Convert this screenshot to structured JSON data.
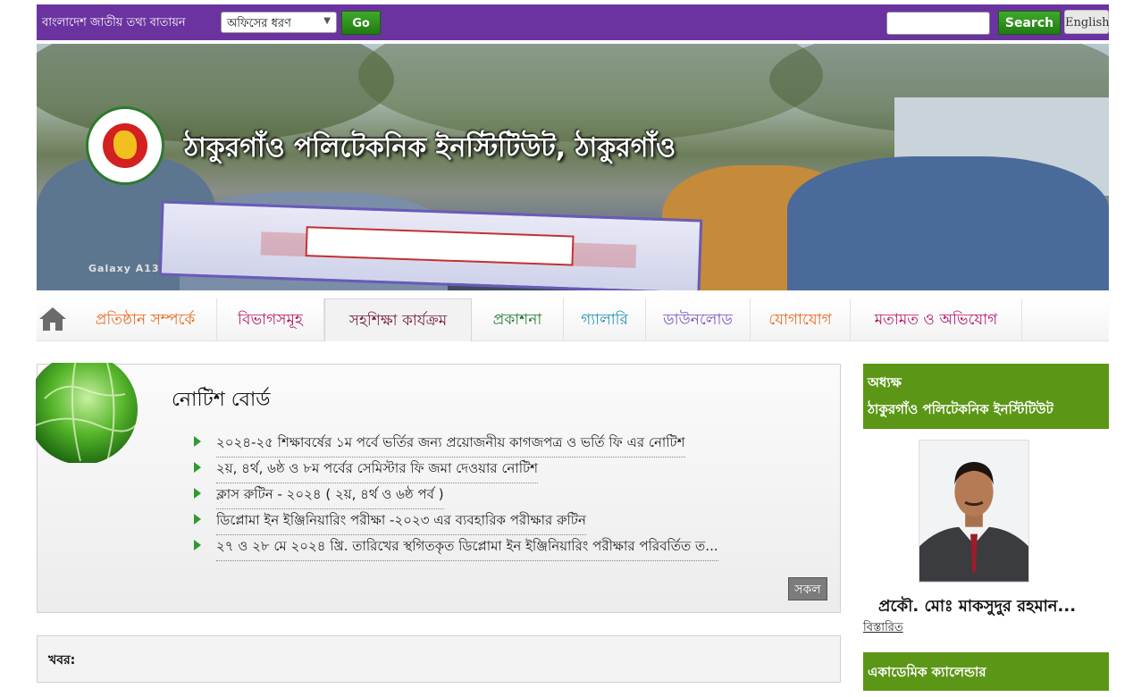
{
  "topbar": {
    "portal_label": "বাংলাদেশ জাতীয় তথ্য বাতায়ন",
    "office_select_value": "অফিসের ধরণ",
    "go_label": "Go",
    "search_placeholder": "",
    "search_label": "Search",
    "language_label": "English"
  },
  "banner": {
    "title": "ঠাকুরগাঁও পলিটেকনিক ইনস্টিটিউট, ঠাকুরগাঁও",
    "camera_mark": "Galaxy A13"
  },
  "nav": {
    "items": [
      {
        "label": "প্রতিষ্ঠান সম্পর্কে",
        "color": "#e8661a"
      },
      {
        "label": "বিভাগসমূহ",
        "color": "#b5136b"
      },
      {
        "label": "সহশিক্ষা কার্যক্রম",
        "color": "#7a1a3a"
      },
      {
        "label": "প্রকাশনা",
        "color": "#1f7a2e"
      },
      {
        "label": "গ্যালারি",
        "color": "#1b8fb8"
      },
      {
        "label": "ডাউনলোড",
        "color": "#7a4fc0"
      },
      {
        "label": "যোগাযোগ",
        "color": "#e8661a"
      },
      {
        "label": "মতামত ও অভিযোগ",
        "color": "#b5136b"
      }
    ]
  },
  "notice": {
    "title": "নোটিশ বোর্ড",
    "items": [
      "২০২৪-২৫ শিক্ষাবর্ষের ১ম পর্বে ভর্তির জন্য প্রয়োজনীয় কাগজপত্র ও ভর্তি ফি এর নোটিশ",
      "২য়, ৪র্থ, ৬ষ্ঠ ও ৮ম পর্বের সেমিস্টার ফি জমা দেওয়ার নোটিশ",
      "ক্লাস রুটিন - ২০২৪ ( ২য়, ৪র্থ ও ৬ষ্ঠ পর্ব )",
      "ডিপ্লোমা ইন ইঞ্জিনিয়ারিং পরীক্ষা -২০২৩ এর ব্যবহারিক পরীক্ষার রুটিন",
      "২৭ ও ২৮ মে ২০২৪ খ্রি. তারিখের স্থগিতকৃত ডিপ্লোমা ইন ইঞ্জিনিয়ারিং পরীক্ষার পরিবর্তিত ত..."
    ],
    "all_label": "সকল"
  },
  "news": {
    "label": "খবর:"
  },
  "sidebar": {
    "principal_title": "অধ্যক্ষ",
    "institute_name": "ঠাকুরগাঁও পলিটেকনিক ইনস্টিটিউট",
    "principal_name": "প্রকৌ. মোঃ মাকসুদুর রহমান...",
    "details_label": "বিস্তারিত",
    "calendar_title": "একাডেমিক ক্যালেন্ডার"
  },
  "colors": {
    "topbar": "#6a33a0",
    "green_button": "#2e8f1e",
    "sidebar_green": "#5c9616"
  }
}
